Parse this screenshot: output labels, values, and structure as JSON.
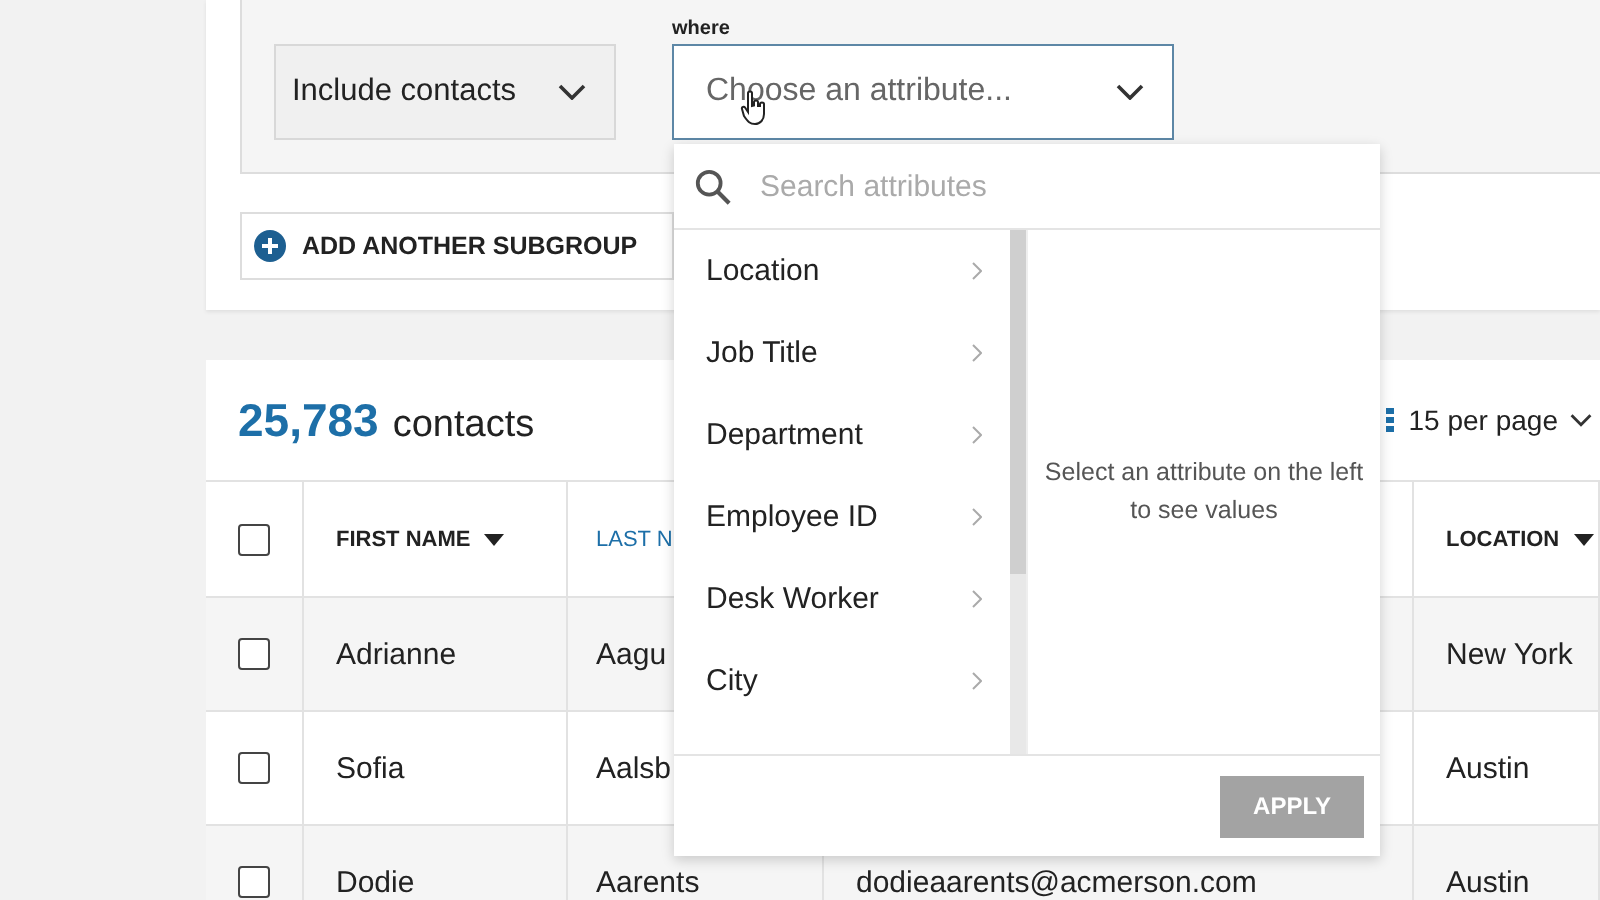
{
  "filter": {
    "mode_select": {
      "value": "Include contacts"
    },
    "where_label": "where",
    "attribute_select": {
      "placeholder": "Choose an attribute..."
    },
    "add_subgroup": "ADD ANOTHER SUBGROUP"
  },
  "results": {
    "count": "25,783",
    "count_label": "contacts",
    "per_page": "15 per page"
  },
  "table": {
    "header_checkbox": {
      "checked": false
    },
    "columns": [
      {
        "label": "FIRST NAME",
        "active": false,
        "caret": true
      },
      {
        "label": "LAST N",
        "active": true,
        "caret": false
      },
      null,
      {
        "label": "LOCATION",
        "active": false,
        "caret": true
      }
    ],
    "rows": [
      {
        "checked": false,
        "cells": [
          "Adrianne",
          "Aagu",
          null,
          "New York"
        ]
      },
      {
        "checked": false,
        "cells": [
          "Sofia",
          "Aalsb",
          null,
          "Austin"
        ]
      },
      {
        "checked": false,
        "cells": [
          "Dodie",
          "Aarents",
          "dodieaarents@acmerson.com",
          "Austin"
        ]
      }
    ]
  },
  "attribute_menu": {
    "search_placeholder": "Search attributes",
    "items": [
      "Location",
      "Job Title",
      "Department",
      "Employee ID",
      "Desk Worker",
      "City"
    ],
    "hint": "Select an attribute on the left to see values",
    "apply": {
      "label": "APPLY",
      "disabled": true
    }
  }
}
